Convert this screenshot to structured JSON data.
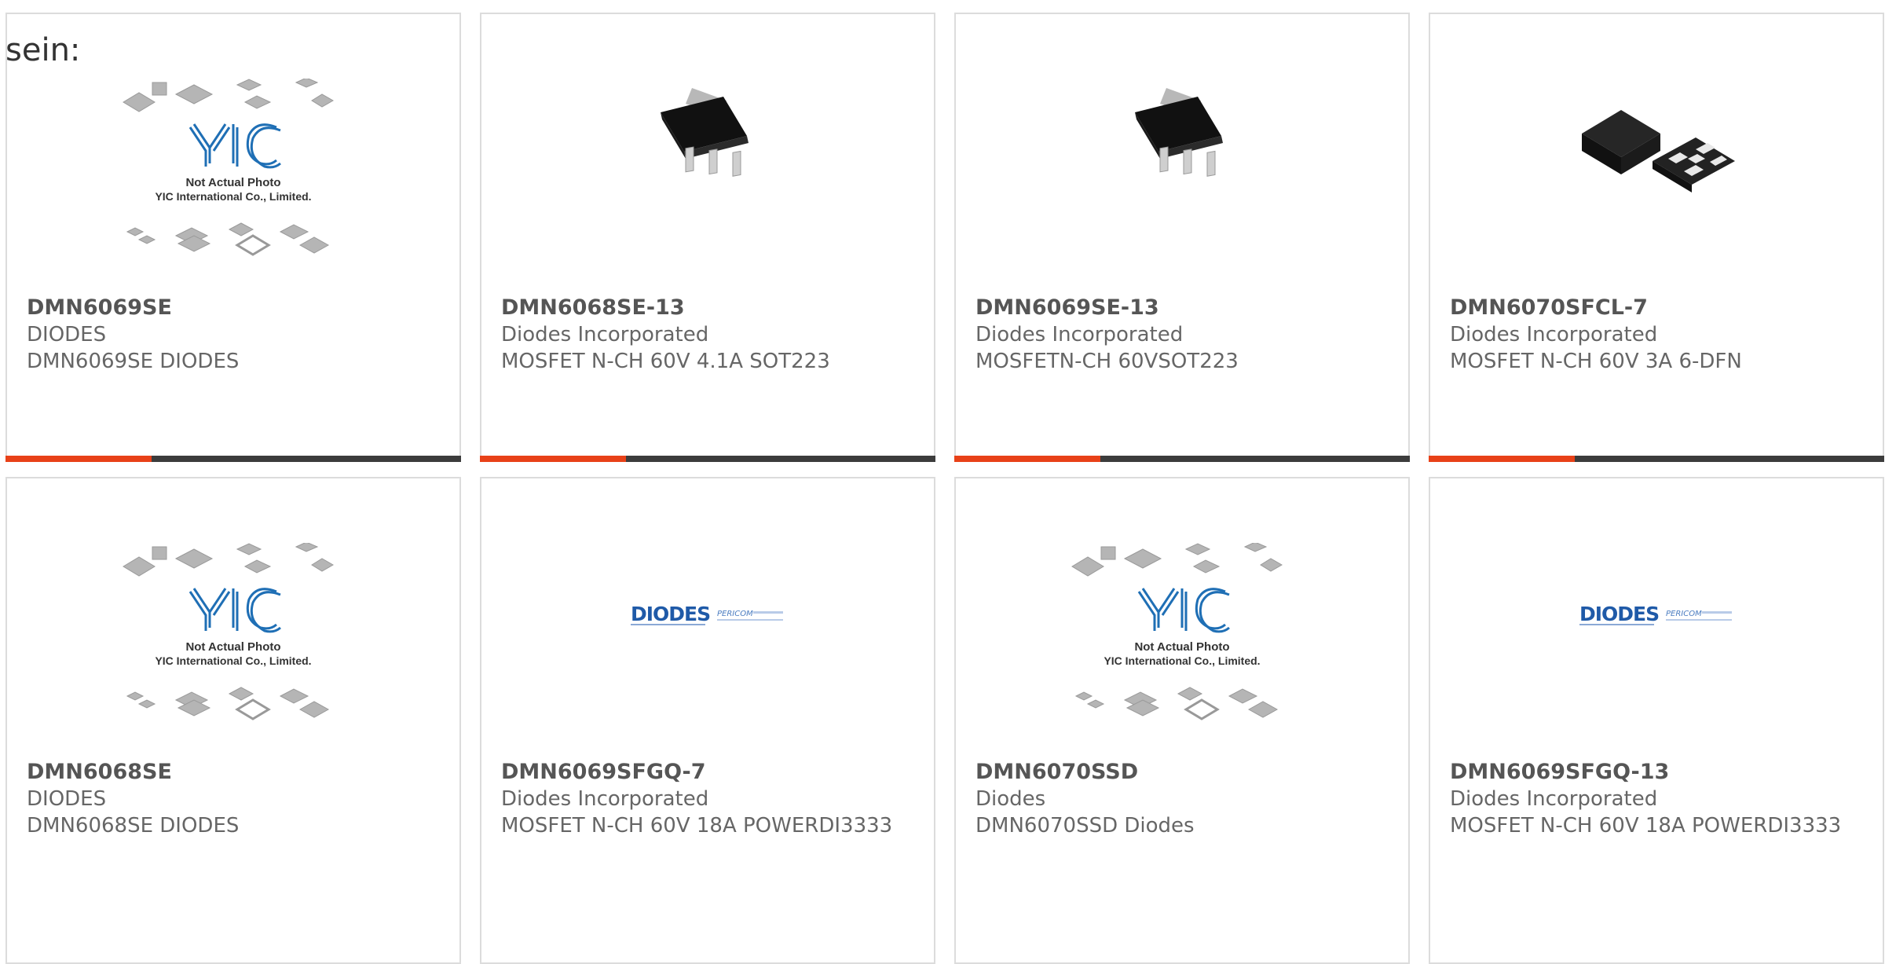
{
  "intro_text": "sein:",
  "placeholder": {
    "logo_text": "YIC",
    "line1": "Not Actual Photo",
    "line2": "YIC International Co., Limited."
  },
  "brand_logo": {
    "name": "DIODES",
    "subtitle": "PERICOM"
  },
  "colors": {
    "accent": "#e84118",
    "bar": "#3c3c3c",
    "border": "#dcdcdc",
    "logo_blue": "#1f6fb5"
  },
  "products": [
    {
      "part": "DMN6069SE",
      "mfr": "DIODES",
      "desc": "DMN6069SE DIODES",
      "image": "not-actual-photo"
    },
    {
      "part": "DMN6068SE-13",
      "mfr": "Diodes Incorporated",
      "desc": "MOSFET N-CH 60V 4.1A SOT223",
      "image": "sot223-chip"
    },
    {
      "part": "DMN6069SE-13",
      "mfr": "Diodes Incorporated",
      "desc": "MOSFETN-CH 60VSOT223",
      "image": "sot223-chip"
    },
    {
      "part": "DMN6070SFCL-7",
      "mfr": "Diodes Incorporated",
      "desc": "MOSFET N-CH 60V 3A 6-DFN",
      "image": "dfn-chip"
    },
    {
      "part": "DMN6068SE",
      "mfr": "DIODES",
      "desc": "DMN6068SE DIODES",
      "image": "not-actual-photo"
    },
    {
      "part": "DMN6069SFGQ-7",
      "mfr": "Diodes Incorporated",
      "desc": "MOSFET N-CH 60V 18A POWERDI3333",
      "image": "diodes-logo"
    },
    {
      "part": "DMN6070SSD",
      "mfr": "Diodes",
      "desc": "DMN6070SSD Diodes",
      "image": "not-actual-photo"
    },
    {
      "part": "DMN6069SFGQ-13",
      "mfr": "Diodes Incorporated",
      "desc": "MOSFET N-CH 60V 18A POWERDI3333",
      "image": "diodes-logo"
    }
  ]
}
